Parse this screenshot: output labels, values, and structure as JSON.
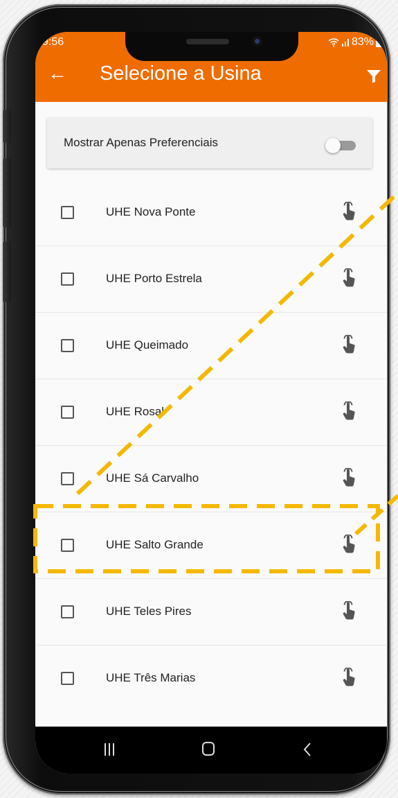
{
  "status_bar": {
    "time": "9:56",
    "battery": "83%"
  },
  "header": {
    "title": "Selecione a Usina",
    "back_icon": "arrow-left-icon",
    "filter_icon": "filter-icon"
  },
  "preferences": {
    "label": "Mostrar Apenas Preferenciais",
    "toggle_on": false
  },
  "usinas": [
    {
      "name": "UHE Nova Ponte",
      "checked": false
    },
    {
      "name": "UHE Porto Estrela",
      "checked": false
    },
    {
      "name": "UHE Queimado",
      "checked": false
    },
    {
      "name": "UHE Rosal",
      "checked": false
    },
    {
      "name": "UHE Sá Carvalho",
      "checked": false
    },
    {
      "name": "UHE Salto Grande",
      "checked": false,
      "highlighted": true
    },
    {
      "name": "UHE Teles Pires",
      "checked": false
    },
    {
      "name": "UHE Três Marias",
      "checked": false
    }
  ],
  "colors": {
    "app_bar": "#ef6c00",
    "annotation": "#f5b800"
  }
}
